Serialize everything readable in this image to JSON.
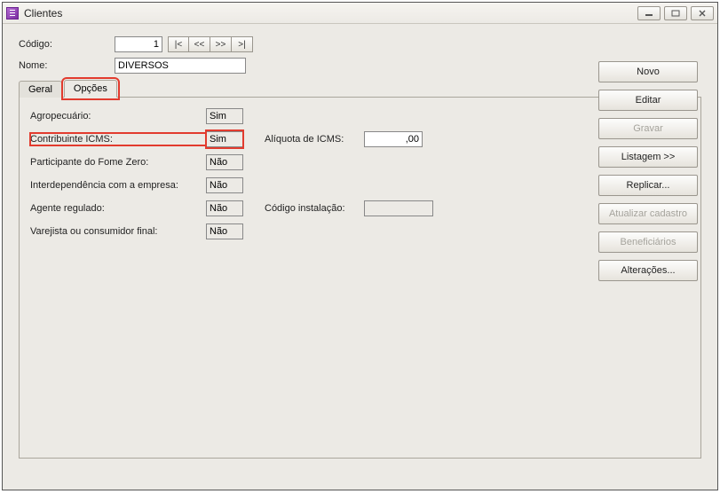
{
  "window": {
    "title": "Clientes"
  },
  "header": {
    "codigo_label": "Código:",
    "codigo_value": "1",
    "nome_label": "Nome:",
    "nome_value": "DIVERSOS",
    "nav": {
      "first": "|<",
      "prev": "<<",
      "next": ">>",
      "last": ">|"
    }
  },
  "tabs": {
    "geral": "Geral",
    "opcoes": "Opções"
  },
  "fields": {
    "agropecuario": {
      "label": "Agropecuário:",
      "value": "Sim"
    },
    "contribuinte_icms": {
      "label": "Contribuinte ICMS:",
      "value": "Sim"
    },
    "aliq_icms": {
      "label": "Alíquota de ICMS:",
      "value": ",00"
    },
    "fome_zero": {
      "label": "Participante do Fome Zero:",
      "value": "Não"
    },
    "interdep": {
      "label": "Interdependência com a empresa:",
      "value": "Não"
    },
    "agente_reg": {
      "label": "Agente regulado:",
      "value": "Não"
    },
    "cod_inst": {
      "label": "Código instalação:",
      "value": ""
    },
    "varejista": {
      "label": "Varejista ou consumidor final:",
      "value": "Não"
    }
  },
  "buttons": {
    "novo": "Novo",
    "editar": "Editar",
    "gravar": "Gravar",
    "listagem": "Listagem >>",
    "replicar": "Replicar...",
    "atualizar": "Atualizar cadastro",
    "beneficiarios": "Beneficiários",
    "alteracoes": "Alterações..."
  }
}
